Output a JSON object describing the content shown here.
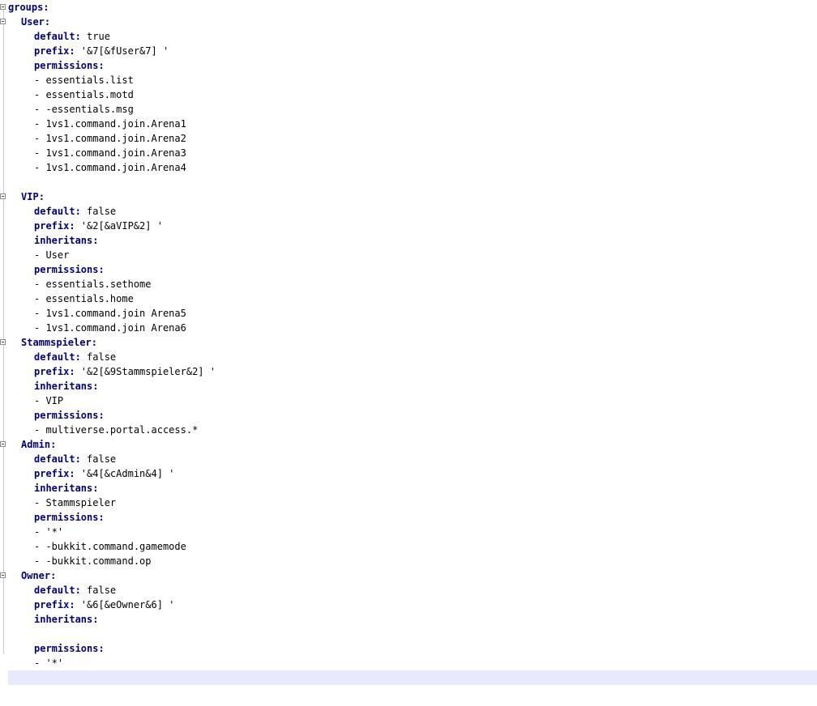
{
  "root_key": "groups",
  "groups": [
    {
      "name": "User",
      "default": "true",
      "prefix": "'&7[&fUser&7] '",
      "permissions": [
        "essentials.list",
        "essentials.motd",
        "-essentials.msg",
        "1vs1.command.join.Arena1",
        "1vs1.command.join.Arena2",
        "1vs1.command.join.Arena3",
        "1vs1.command.join.Arena4"
      ]
    },
    {
      "name": "VIP",
      "default": "false",
      "prefix": "'&2[&aVIP&2] '",
      "inheritance": [
        "User"
      ],
      "permissions": [
        "essentials.sethome",
        "essentials.home",
        "1vs1.command.join Arena5",
        "1vs1.command.join Arena6"
      ]
    },
    {
      "name": "Stammspieler",
      "default": "false",
      "prefix": "'&2[&9Stammspieler&2] '",
      "inheritance": [
        "VIP"
      ],
      "permissions": [
        "multiverse.portal.access.*"
      ]
    },
    {
      "name": "Admin",
      "default": "false",
      "prefix": "'&4[&cAdmin&4] '",
      "inheritance": [
        "Stammspieler"
      ],
      "permissions": [
        "'*'",
        "-bukkit.command.gamemode",
        "-bukkit.command.op"
      ]
    },
    {
      "name": "Owner",
      "default": "false",
      "prefix": "'&6[&eOwner&6] '",
      "inheritance": [],
      "permissions": [
        "'*'"
      ]
    }
  ],
  "keys": {
    "default": "default:",
    "prefix": "prefix:",
    "inheritance": "inheritans:",
    "permissions": "permissions:"
  },
  "list_dash": "- "
}
